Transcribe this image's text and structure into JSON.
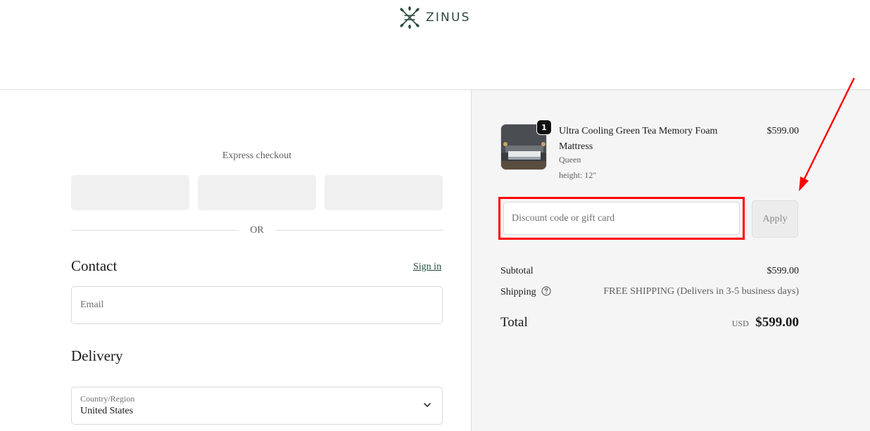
{
  "brand": {
    "name": "ZINUS",
    "logo_icon": "leaf-cross-logo-icon",
    "color": "#2c4a3c"
  },
  "express_checkout": {
    "title": "Express checkout",
    "divider_label": "OR",
    "buttons": 3
  },
  "contact": {
    "title": "Contact",
    "sign_in_label": "Sign in",
    "email_placeholder": "Email"
  },
  "delivery": {
    "title": "Delivery",
    "country_label": "Country/Region",
    "country_value": "United States"
  },
  "order": {
    "product": {
      "name": "Ultra Cooling Green Tea Memory Foam Mattress",
      "variant_size": "Queen",
      "variant_height": "height: 12\"",
      "price": "$599.00",
      "quantity": "1"
    },
    "discount_placeholder": "Discount code or gift card",
    "apply_label": "Apply",
    "subtotal_label": "Subtotal",
    "subtotal_value": "$599.00",
    "shipping_label": "Shipping",
    "shipping_value": "FREE SHIPPING (Delivers in 3-5 business days)",
    "total_label": "Total",
    "total_currency": "USD",
    "total_value": "$599.00"
  },
  "annotation": {
    "highlight_color": "#ff0000"
  }
}
